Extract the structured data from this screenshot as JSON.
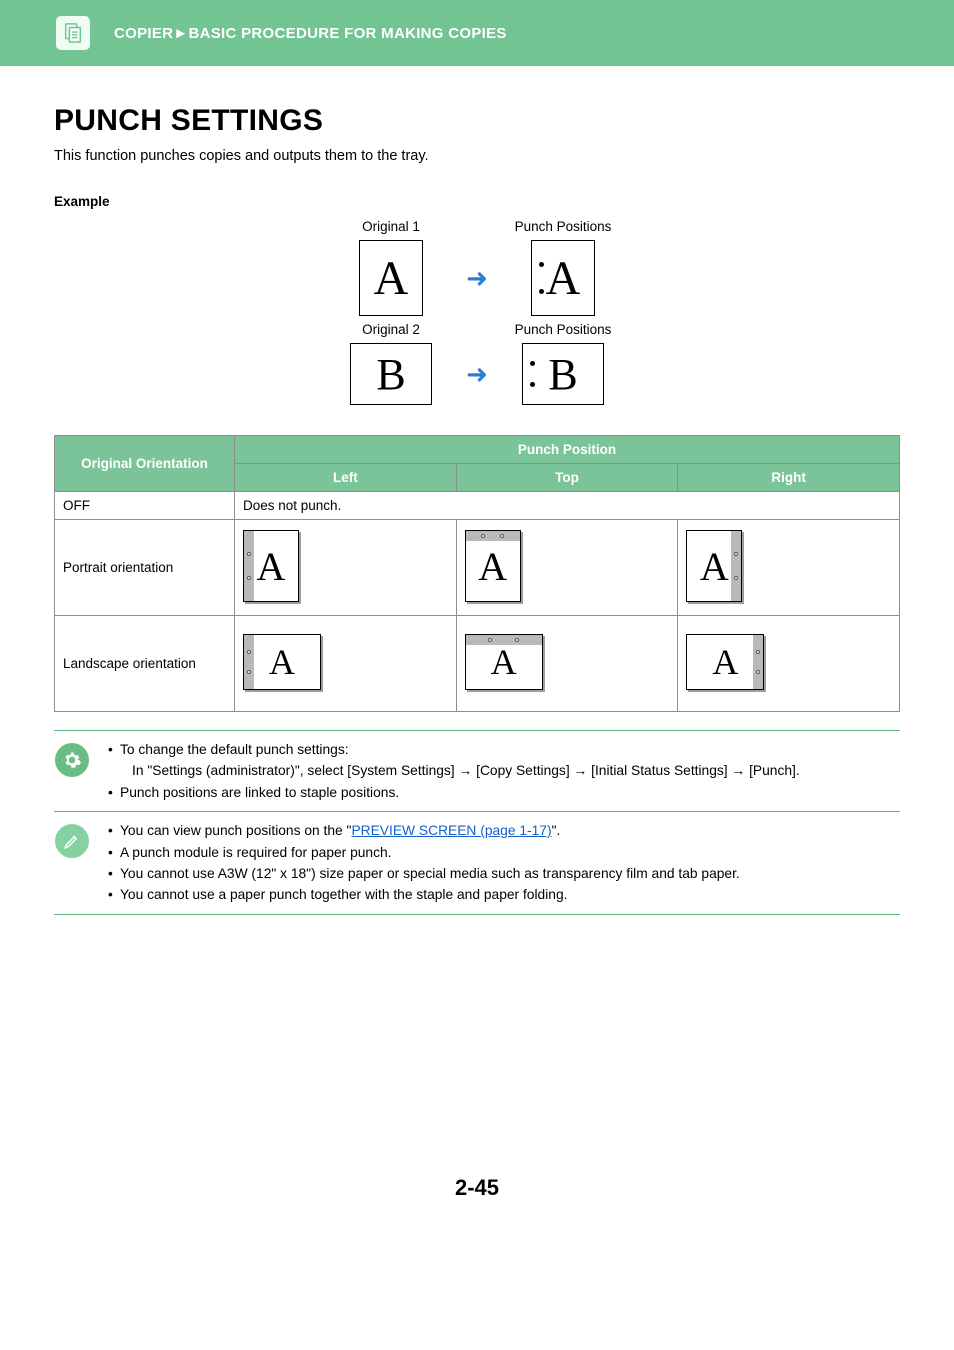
{
  "header": {
    "breadcrumb_section": "COPIER",
    "breadcrumb_sep": "►",
    "breadcrumb_title": "BASIC PROCEDURE FOR MAKING COPIES"
  },
  "page": {
    "title": "PUNCH SETTINGS",
    "intro": "This function punches copies and outputs them to the tray.",
    "example_label": "Example",
    "number": "2-45"
  },
  "example": {
    "orig1_label": "Original 1",
    "orig2_label": "Original 2",
    "result_label": "Punch Positions",
    "letterA": "A",
    "letterB": "B"
  },
  "table": {
    "col_orientation": "Original Orientation",
    "col_position": "Punch Position",
    "col_left": "Left",
    "col_top": "Top",
    "col_right": "Right",
    "row_off": "OFF",
    "row_off_text": "Does not punch.",
    "row_portrait": "Portrait orientation",
    "row_landscape": "Landscape orientation",
    "glyph": "A"
  },
  "notes1": {
    "b1": "To change the default punch settings:",
    "b1sub": "In \"Settings (administrator)\", select [System Settings] → [Copy Settings] → [Initial Status Settings] → [Punch].",
    "b2": "Punch positions are linked to staple positions."
  },
  "notes2": {
    "b1_pre": "You can view punch positions on the \"",
    "b1_link": "PREVIEW SCREEN (page 1-17)",
    "b1_post": "\".",
    "b2": "A punch module is required for paper punch.",
    "b3": "You cannot use A3W (12\" x 18\") size paper or special media such as transparency film and tab paper.",
    "b4": "You cannot use a paper punch together with the staple and paper folding."
  }
}
